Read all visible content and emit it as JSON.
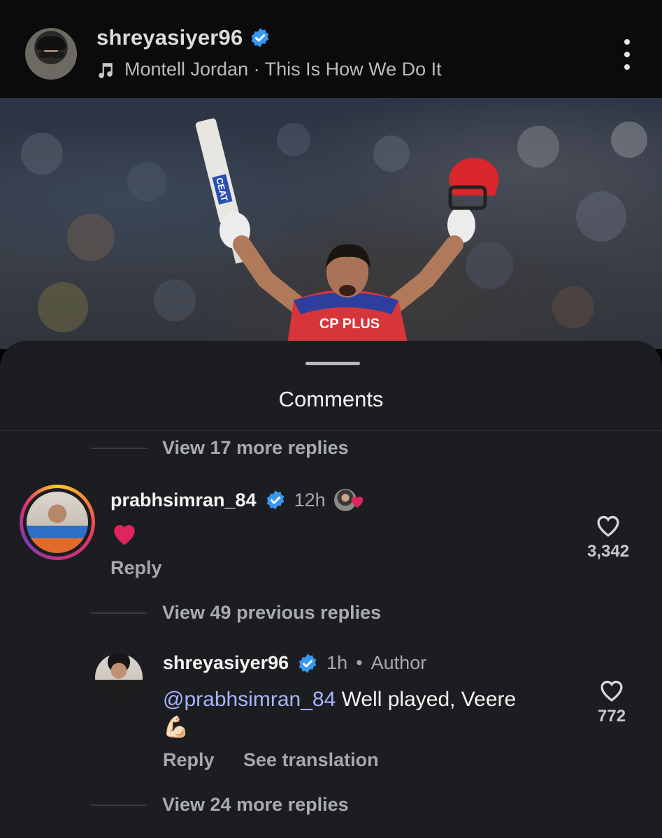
{
  "post": {
    "username": "shreyasiyer96",
    "song": "Montell Jordan · This Is How We Do It",
    "photo_text": {
      "bat_brand": "CEAT",
      "jersey_sponsor": "CP PLUS"
    }
  },
  "sheet": {
    "title": "Comments"
  },
  "replies_top": {
    "label": "View 17 more replies"
  },
  "comment": {
    "username": "prabhsimran_84",
    "time": "12h",
    "text": "❤️",
    "reply_label": "Reply",
    "likes": "3,342"
  },
  "replies_previous": {
    "label": "View 49 previous replies"
  },
  "reply": {
    "username": "shreyasiyer96",
    "time": "1h",
    "author_label": "Author",
    "mention": "@prabhsimran_84",
    "text": " Well played, Veere",
    "emoji": "💪🏻",
    "reply_label": "Reply",
    "translate_label": "See translation",
    "likes": "772"
  },
  "replies_bottom": {
    "label": "View 24 more replies"
  },
  "colors": {
    "verified": "#3797f0",
    "heart": "#e0245e",
    "mention": "#a7b6ff",
    "sheet_bg": "#1c1d20"
  },
  "icons": [
    "verified-badge-icon",
    "music-note-icon",
    "more-options-icon",
    "heart-outline-icon",
    "red-heart-emoji",
    "flexed-biceps-emoji"
  ]
}
